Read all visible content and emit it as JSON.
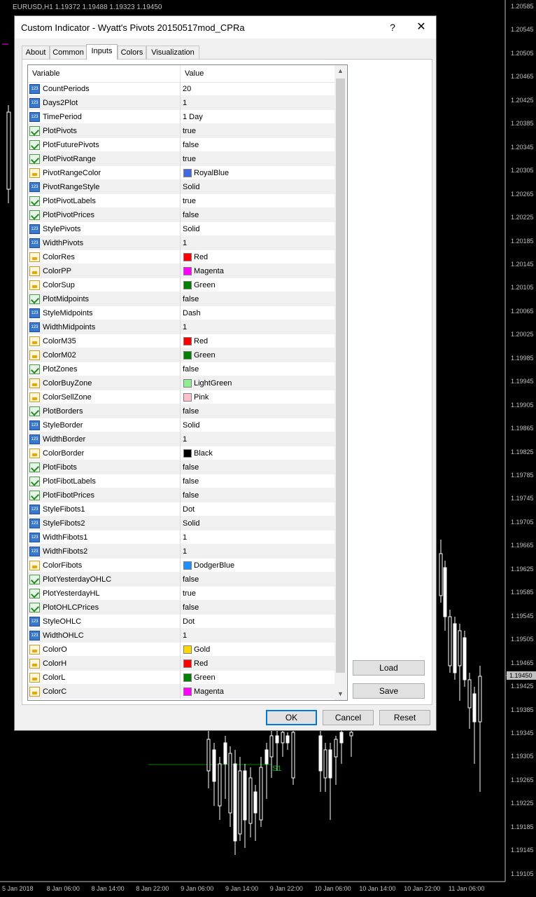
{
  "chart": {
    "symbol_info": "EURUSD,H1  1.19372 1.19488 1.19323 1.19450",
    "price_levels": [
      "1.20585",
      "1.20545",
      "1.20505",
      "1.20465",
      "1.20425",
      "1.20385",
      "1.20345",
      "1.20305",
      "1.20265",
      "1.20225",
      "1.20185",
      "1.20145",
      "1.20105",
      "1.20065",
      "1.20025",
      "1.19985",
      "1.19945",
      "1.19905",
      "1.19865",
      "1.19825",
      "1.19785",
      "1.19745",
      "1.19705",
      "1.19665",
      "1.19625",
      "1.19585",
      "1.19545",
      "1.19505",
      "1.19465",
      "1.19425",
      "1.19385",
      "1.19345",
      "1.19305",
      "1.19265",
      "1.19225",
      "1.19185",
      "1.19145",
      "1.19105"
    ],
    "current_price": "1.19450",
    "time_labels": [
      "5 Jan 2018",
      "8 Jan 06:00",
      "8 Jan 14:00",
      "8 Jan 22:00",
      "9 Jan 06:00",
      "9 Jan 14:00",
      "9 Jan 22:00",
      "10 Jan 06:00",
      "10 Jan 14:00",
      "10 Jan 22:00",
      "11 Jan 06:00"
    ],
    "pivot_label": "S1"
  },
  "dialog": {
    "title": "Custom Indicator - Wyatt's Pivots 20150517mod_CPRa",
    "help_label": "?",
    "close_label": "✕",
    "tabs": [
      "About",
      "Common",
      "Inputs",
      "Colors",
      "Visualization"
    ],
    "active_tab": "Inputs",
    "grid": {
      "header_variable": "Variable",
      "header_value": "Value",
      "rows": [
        {
          "type": "int",
          "name": "CountPeriods",
          "value": "20"
        },
        {
          "type": "int",
          "name": "Days2Plot",
          "value": "1"
        },
        {
          "type": "int",
          "name": "TimePeriod",
          "value": "1 Day"
        },
        {
          "type": "bool",
          "name": "PlotPivots",
          "value": "true"
        },
        {
          "type": "bool",
          "name": "PlotFuturePivots",
          "value": "false"
        },
        {
          "type": "bool",
          "name": "PlotPivotRange",
          "value": "true"
        },
        {
          "type": "color",
          "name": "PivotRangeColor",
          "value": "RoyalBlue",
          "swatch": "#4169e1"
        },
        {
          "type": "int",
          "name": "PivotRangeStyle",
          "value": "Solid"
        },
        {
          "type": "bool",
          "name": "PlotPivotLabels",
          "value": "true"
        },
        {
          "type": "bool",
          "name": "PlotPivotPrices",
          "value": "false"
        },
        {
          "type": "int",
          "name": "StylePivots",
          "value": "Solid"
        },
        {
          "type": "int",
          "name": "WidthPivots",
          "value": "1"
        },
        {
          "type": "color",
          "name": "ColorRes",
          "value": "Red",
          "swatch": "#ff0000"
        },
        {
          "type": "color",
          "name": "ColorPP",
          "value": "Magenta",
          "swatch": "#ff00ff"
        },
        {
          "type": "color",
          "name": "ColorSup",
          "value": "Green",
          "swatch": "#008000"
        },
        {
          "type": "bool",
          "name": "PlotMidpoints",
          "value": "false"
        },
        {
          "type": "int",
          "name": "StyleMidpoints",
          "value": "Dash"
        },
        {
          "type": "int",
          "name": "WidthMidpoints",
          "value": "1"
        },
        {
          "type": "color",
          "name": "ColorM35",
          "value": "Red",
          "swatch": "#ff0000"
        },
        {
          "type": "color",
          "name": "ColorM02",
          "value": "Green",
          "swatch": "#008000"
        },
        {
          "type": "bool",
          "name": "PlotZones",
          "value": "false"
        },
        {
          "type": "color",
          "name": "ColorBuyZone",
          "value": "LightGreen",
          "swatch": "#90ee90"
        },
        {
          "type": "color",
          "name": "ColorSellZone",
          "value": "Pink",
          "swatch": "#ffc0cb"
        },
        {
          "type": "bool",
          "name": "PlotBorders",
          "value": "false"
        },
        {
          "type": "int",
          "name": "StyleBorder",
          "value": "Solid"
        },
        {
          "type": "int",
          "name": "WidthBorder",
          "value": "1"
        },
        {
          "type": "color",
          "name": "ColorBorder",
          "value": "Black",
          "swatch": "#000000"
        },
        {
          "type": "bool",
          "name": "PlotFibots",
          "value": "false"
        },
        {
          "type": "bool",
          "name": "PlotFibotLabels",
          "value": "false"
        },
        {
          "type": "bool",
          "name": "PlotFibotPrices",
          "value": "false"
        },
        {
          "type": "int",
          "name": "StyleFibots1",
          "value": "Dot"
        },
        {
          "type": "int",
          "name": "StyleFibots2",
          "value": "Solid"
        },
        {
          "type": "int",
          "name": "WidthFibots1",
          "value": "1"
        },
        {
          "type": "int",
          "name": "WidthFibots2",
          "value": "1"
        },
        {
          "type": "color",
          "name": "ColorFibots",
          "value": "DodgerBlue",
          "swatch": "#1e90ff"
        },
        {
          "type": "bool",
          "name": "PlotYesterdayOHLC",
          "value": "false"
        },
        {
          "type": "bool",
          "name": "PlotYesterdayHL",
          "value": "true"
        },
        {
          "type": "bool",
          "name": "PlotOHLCPrices",
          "value": "false"
        },
        {
          "type": "int",
          "name": "StyleOHLC",
          "value": "Dot"
        },
        {
          "type": "int",
          "name": "WidthOHLC",
          "value": "1"
        },
        {
          "type": "color",
          "name": "ColorO",
          "value": "Gold",
          "swatch": "#ffd700"
        },
        {
          "type": "color",
          "name": "ColorH",
          "value": "Red",
          "swatch": "#ff0000"
        },
        {
          "type": "color",
          "name": "ColorL",
          "value": "Green",
          "swatch": "#008000"
        },
        {
          "type": "color",
          "name": "ColorC",
          "value": "Magenta",
          "swatch": "#ff00ff"
        }
      ]
    },
    "buttons": {
      "load": "Load",
      "save": "Save",
      "ok": "OK",
      "cancel": "Cancel",
      "reset": "Reset"
    }
  }
}
